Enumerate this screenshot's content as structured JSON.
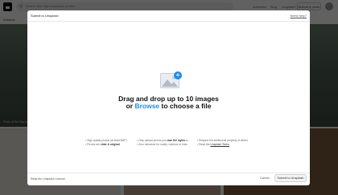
{
  "header": {
    "search_placeholder": "Search free high-resolution photos",
    "links": [
      "Advertise",
      "Blog",
      "Unsplash+"
    ],
    "submit_label": "Submit a photo"
  },
  "tabs": [
    "Editorial"
  ],
  "hero": {
    "caption": "Photo of the Day by"
  },
  "modal": {
    "title": "Submit to Unsplash",
    "help_link": "Need help?",
    "drop": {
      "line1": "Drag and drop up to 10 images",
      "line2_prefix": "or",
      "browse": "Browse",
      "line2_suffix": "to choose a file"
    },
    "requirements": {
      "col1": [
        {
          "pre": "High quality photos",
          "bold": "",
          "post": " (at least 5MP)"
        },
        {
          "pre": "Photos are ",
          "bold": "clear & original",
          "post": ""
        }
      ],
      "col2": [
        {
          "pre": "Only upload photos you ",
          "bold": "own the rights",
          "post": " to"
        },
        {
          "pre": "Zero tolerance for nudity, violence or hate",
          "bold": "",
          "post": ""
        }
      ],
      "col3": [
        {
          "pre": "Respect the intellectual property of others",
          "bold": "",
          "post": ""
        },
        {
          "pre": "Read the ",
          "bold": "Unsplash Terms",
          "post": ""
        }
      ]
    },
    "footer": {
      "license_link": "Read the Unsplash License",
      "cancel": "Cancel",
      "submit": "Submit to Unsplash"
    }
  },
  "colors": {
    "accent": "#1f8cf0",
    "overlay": "rgba(0,0,0,0.62)"
  },
  "icons": [
    "unsplash-logo",
    "search-icon",
    "image-upload-icon",
    "plus-icon"
  ]
}
